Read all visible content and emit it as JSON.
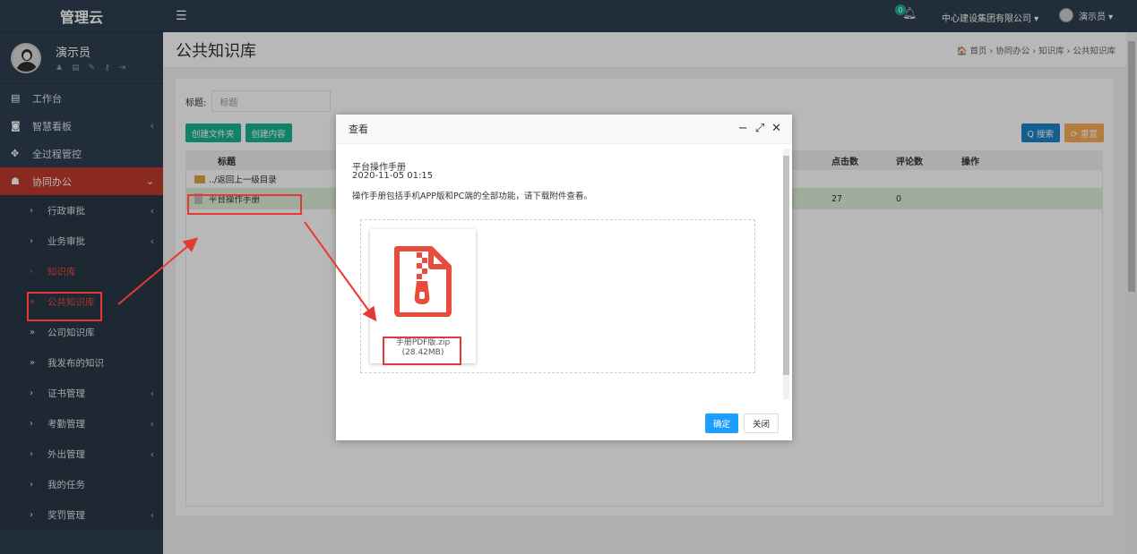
{
  "app": {
    "title": "管理云"
  },
  "profile": {
    "name": "演示员"
  },
  "topbar": {
    "menu_icon": "hamburger-icon",
    "notification_count": "0",
    "company": "中心建设集团有限公司 ▾",
    "user": "演示员 ▾"
  },
  "sidebar": {
    "items": [
      {
        "label": "工作台",
        "icon": "desktop-icon"
      },
      {
        "label": "智慧看板",
        "icon": "dashboard-icon"
      },
      {
        "label": "全过程管控",
        "icon": "crosshair-icon"
      },
      {
        "label": "协同办公",
        "icon": "users-icon"
      }
    ],
    "subitems": [
      {
        "label": "行政审批"
      },
      {
        "label": "业务审批"
      },
      {
        "label": "知识库"
      },
      {
        "label": "公共知识库"
      },
      {
        "label": "公司知识库"
      },
      {
        "label": "我发布的知识"
      },
      {
        "label": "证书管理"
      },
      {
        "label": "考勤管理"
      },
      {
        "label": "外出管理"
      },
      {
        "label": "我的任务"
      },
      {
        "label": "奖罚管理"
      }
    ]
  },
  "page": {
    "title": "公共知识库",
    "breadcrumb": "🏠 首页 › 协同办公 › 知识库 › 公共知识库"
  },
  "filter": {
    "label": "标题:",
    "placeholder": "标题"
  },
  "buttons": {
    "create_folder": "创建文件夹",
    "create_content": "创建内容",
    "search": "Q 搜索",
    "reset": "⟳ 重置"
  },
  "table": {
    "headers": {
      "title": "标题",
      "clicks": "点击数",
      "comments": "评论数",
      "ops": "操作"
    },
    "rows": [
      {
        "name": "../返回上一级目录",
        "clicks": "",
        "comments": ""
      },
      {
        "name": "平台操作手册",
        "clicks": "27",
        "comments": "0"
      }
    ]
  },
  "modal": {
    "title": "查看",
    "doc_title": "平台操作手册",
    "doc_date": "2020-11-05 01:15",
    "doc_desc": "操作手册包括手机APP版和PC端的全部功能，请下载附件查看。",
    "attachment": {
      "name": "手册PDF版.zip",
      "size": "(28.42MB)"
    },
    "ok": "确定",
    "close": "关闭"
  }
}
